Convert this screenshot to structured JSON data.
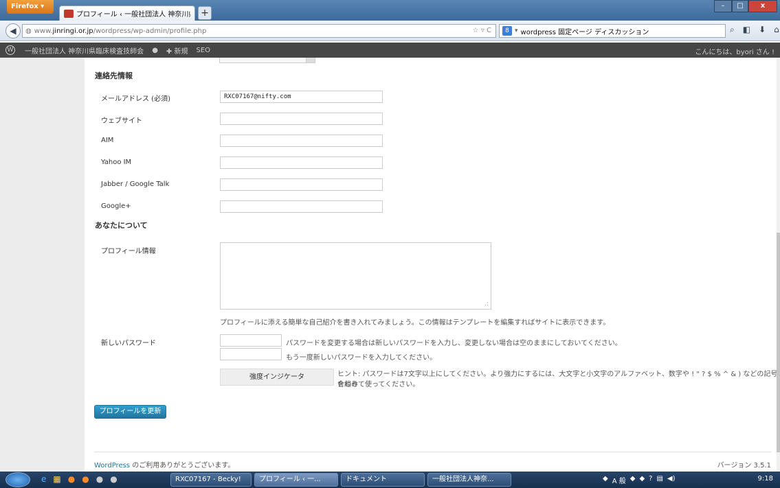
{
  "browser": {
    "menu_label": "Firefox",
    "tab_title": "プロフィール ‹ 一般社団法人 神奈川県...",
    "new_tab": "+",
    "url_prefix": "www.",
    "url_domain": "jinringi.or.jp",
    "url_path": "/wordpress/wp-admin/profile.php",
    "search_text": "wordpress 固定ページ ディスカッション",
    "window": {
      "minimize": "–",
      "maximize": "□",
      "close": "x"
    }
  },
  "adminbar": {
    "site_name": "一般社団法人 神奈川県臨床検査技師会",
    "comments_icon": "comment-icon",
    "new_label": "新規",
    "seo_label": "SEO",
    "greeting": "こんにちは、byori さん !"
  },
  "contact": {
    "heading": "連絡先情報",
    "email_label": "メールアドレス (必須)",
    "email_value": "RXC07167@nifty.com",
    "website_label": "ウェブサイト",
    "aim_label": "AIM",
    "yahoo_label": "Yahoo IM",
    "jabber_label": "Jabber / Google Talk",
    "gplus_label": "Google+"
  },
  "about": {
    "heading": "あなたについて",
    "bio_label": "プロフィール情報",
    "bio_desc": "プロフィールに添える簡単な自己紹介を書き入れてみましょう。この情報はテンプレートを編集すればサイトに表示できます。",
    "pw_label": "新しいパスワード",
    "pw_desc1": "パスワードを変更する場合は新しいパスワードを入力し、変更しない場合は空のままにしておいてください。",
    "pw_desc2": "もう一度新しいパスワードを入力してください。",
    "strength_label": "強度インジケータ",
    "hint_line1": "ヒント: パスワードは7文字以上にしてください。より強力にするには、大文字と小文字のアルファベット、数字や ! \" ? $ % ^ & ) などの記号を組み",
    "hint_line2": "合わせて使ってください。"
  },
  "update_button": "プロフィールを更新",
  "footer": {
    "wp_link": "WordPress",
    "thanks": " のご利用ありがとうございます。",
    "version": "バージョン 3.5.1"
  },
  "taskbar": {
    "tasks": [
      "RXC07167 - Becky!",
      "プロフィール ‹ 一...",
      "ドキュメント",
      "一般社団法人神奈..."
    ],
    "clock": "9:18"
  }
}
